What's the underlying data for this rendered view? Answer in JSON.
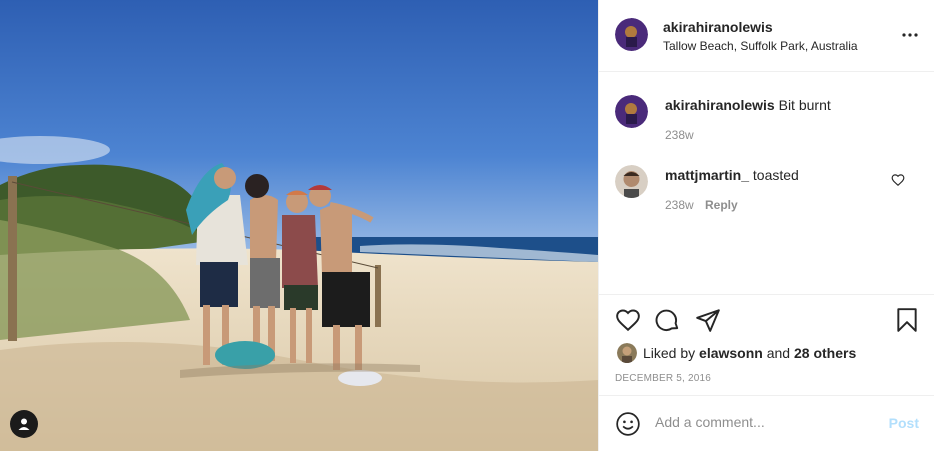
{
  "post": {
    "username": "akirahiranolewis",
    "location": "Tallow Beach, Suffolk Park, Australia"
  },
  "comments": [
    {
      "username": "akirahiranolewis",
      "text": "Bit burnt",
      "time": "238w"
    },
    {
      "username": "mattjmartin_",
      "text": "toasted",
      "time": "238w",
      "reply_label": "Reply"
    }
  ],
  "likes": {
    "prefix": "Liked by",
    "user": "elawsonn",
    "connector": "and",
    "others": "28 others"
  },
  "date": "DECEMBER 5, 2016",
  "add_comment": {
    "placeholder": "Add a comment...",
    "post_label": "Post"
  },
  "icons": {
    "more": "more-horizontal-icon",
    "like": "heart-icon",
    "comment": "comment-bubble-icon",
    "share": "paper-plane-icon",
    "save": "bookmark-icon",
    "emoji": "smiley-icon",
    "tag": "user-tag-icon"
  },
  "colors": {
    "post_button_disabled": "#b2dffc",
    "secondary_text": "#8e8e8e",
    "primary_text": "#262626"
  }
}
